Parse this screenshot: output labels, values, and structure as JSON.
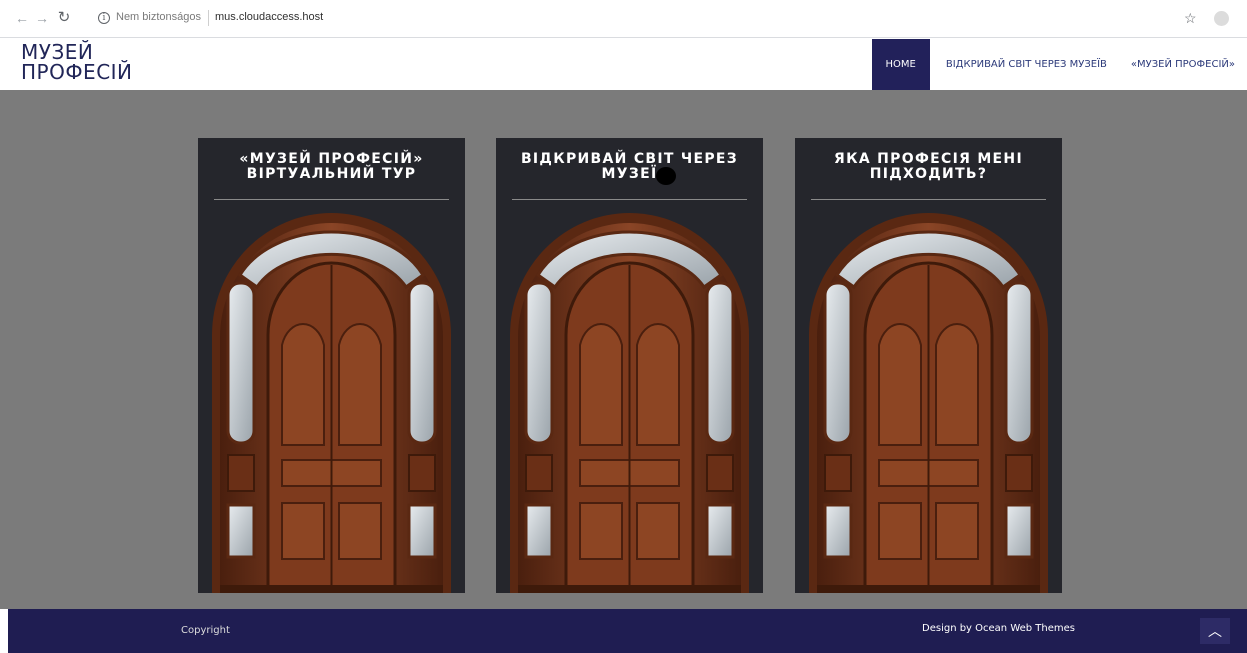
{
  "browser": {
    "security_label": "Nem biztonságos",
    "url": "mus.cloudaccess.host"
  },
  "header": {
    "logo_line1": "МУЗЕЙ",
    "logo_line2": "ПРОФЕСІЙ",
    "menu": [
      {
        "label": "HOME",
        "active": true
      },
      {
        "label": "ВІДКРИВАЙ СВІТ ЧЕРЕЗ МУЗЕЇВ",
        "active": false
      },
      {
        "label": "«МУЗЕЙ ПРОФЕСІЙ»",
        "active": false
      }
    ]
  },
  "cards": [
    {
      "title_line1": "«МУЗЕЙ ПРОФЕСІЙ»",
      "title_line2": "ВІРТУАЛЬНИЙ ТУР"
    },
    {
      "title_line1": "ВІДКРИВАЙ СВІТ ЧЕРЕЗ",
      "title_line2": "МУЗЕЇ"
    },
    {
      "title_line1": "ЯКА ПРОФЕСІЯ МЕНІ",
      "title_line2": "ПІДХОДИТЬ?"
    }
  ],
  "footer": {
    "copyright": "Copyright",
    "credits": "Design by Ocean Web Themes"
  },
  "colors": {
    "brand_dark": "#22215a",
    "main_bg": "#7b7b7b",
    "card_bg": "#25262c",
    "wood": "#7a3a1e"
  }
}
